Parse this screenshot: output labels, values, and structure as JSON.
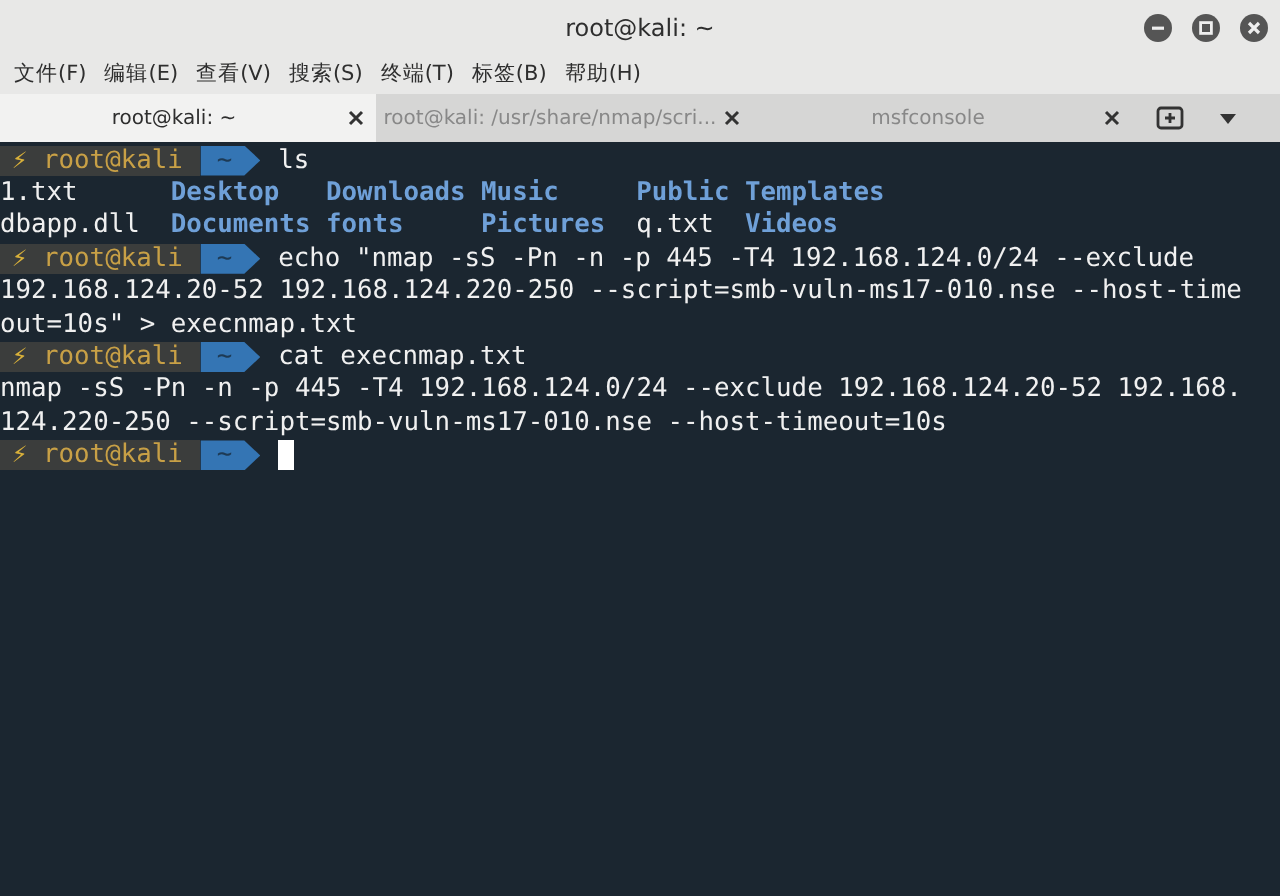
{
  "window": {
    "title": "root@kali: ~"
  },
  "menu": [
    "文件(F)",
    "编辑(E)",
    "查看(V)",
    "搜索(S)",
    "终端(T)",
    "标签(B)",
    "帮助(H)"
  ],
  "tabs": [
    {
      "label": "root@kali: ~",
      "selected": true
    },
    {
      "label": "root@kali: /usr/share/nmap/scri...",
      "selected": false
    },
    {
      "label": "msfconsole",
      "selected": false
    }
  ],
  "terminal": {
    "lines": [
      {
        "kind": "prompt",
        "symbol": "⚡",
        "user": "root@kali",
        "dir": "~",
        "command": "ls"
      },
      {
        "kind": "listing",
        "entries": [
          {
            "name": "1.txt",
            "kind": "file"
          },
          {
            "name": "Desktop",
            "kind": "dir"
          },
          {
            "name": "Downloads",
            "kind": "dir"
          },
          {
            "name": "Music",
            "kind": "dir"
          },
          {
            "name": "Public",
            "kind": "dir"
          },
          {
            "name": "Templates",
            "kind": "dir"
          }
        ]
      },
      {
        "kind": "listing",
        "entries": [
          {
            "name": "dbapp.dll",
            "kind": "file"
          },
          {
            "name": "Documents",
            "kind": "dir"
          },
          {
            "name": "fonts",
            "kind": "dir"
          },
          {
            "name": "Pictures",
            "kind": "dir"
          },
          {
            "name": "q.txt",
            "kind": "file"
          },
          {
            "name": "Videos",
            "kind": "dir"
          }
        ]
      },
      {
        "kind": "prompt",
        "symbol": "⚡",
        "user": "root@kali",
        "dir": "~",
        "command": "echo \"nmap -sS -Pn -n -p 445 -T4 192.168.124.0/24 --exclude"
      },
      {
        "kind": "output",
        "text": "192.168.124.20-52 192.168.124.220-250 --script=smb-vuln-ms17-010.nse --host-time"
      },
      {
        "kind": "output",
        "text": "out=10s\" > execnmap.txt"
      },
      {
        "kind": "prompt",
        "symbol": "⚡",
        "user": "root@kali",
        "dir": "~",
        "command": "cat execnmap.txt"
      },
      {
        "kind": "output",
        "text": "nmap -sS -Pn -n -p 445 -T4 192.168.124.0/24 --exclude 192.168.124.20-52 192.168."
      },
      {
        "kind": "output",
        "text": "124.220-250 --script=smb-vuln-ms17-010.nse --host-timeout=10s"
      },
      {
        "kind": "prompt",
        "symbol": "⚡",
        "user": "root@kali",
        "dir": "~",
        "cursor": true
      }
    ]
  }
}
